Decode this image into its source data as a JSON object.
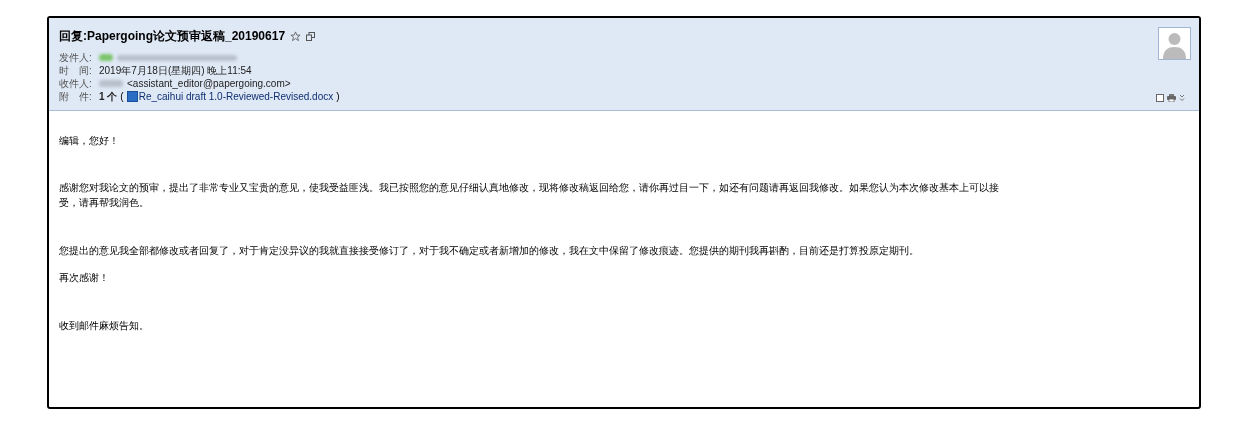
{
  "email": {
    "subject": "回复:Papergoing论文预审返稿_20190617",
    "starred": false,
    "fields": [
      {
        "kind": "sender",
        "label": "发件人:"
      },
      {
        "kind": "text",
        "label": "时　间:",
        "value": "2019年7月18日(星期四) 晚上11:54"
      },
      {
        "kind": "recipient",
        "label": "收件人:",
        "value": "<assistant_editor@papergoing.com>"
      },
      {
        "kind": "attachment",
        "label": "附　件:",
        "count": "1 个",
        "open": "(",
        "file": "Re_caihui draft 1.0-Reviewed-Revised.docx",
        "close": ")"
      }
    ],
    "body": [
      "编辑，您好！",
      "感谢您对我论文的预审，提出了非常专业又宝贵的意见，使我受益匪浅。我已按照您的意见仔细认真地修改，现将修改稿返回给您，请你再过目一下，如还有问题请再返回我修改。如果您认为本次修改基本上可以接受，请再帮我润色。",
      "您提出的意见我全部都修改或者回复了，对于肯定没异议的我就直接接受修订了，对于我不确定或者新增加的修改，我在文中保留了修改痕迹。您提供的期刊我再斟酌，目前还是打算投原定期刊。",
      "再次感谢！",
      "收到邮件麻烦告知。"
    ]
  }
}
